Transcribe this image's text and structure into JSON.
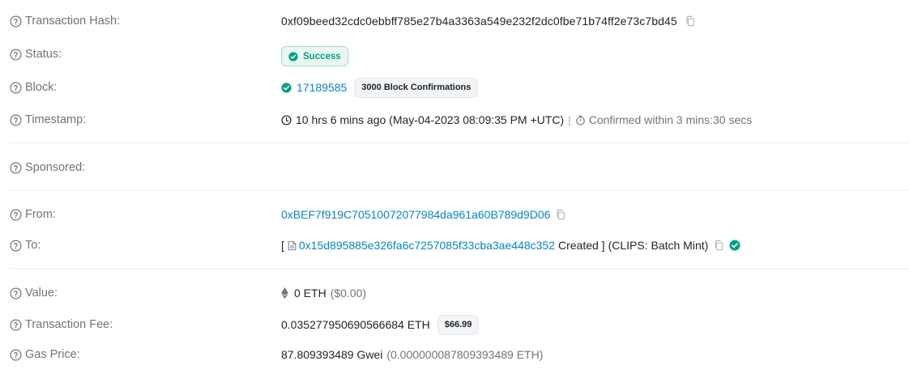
{
  "rows": {
    "tx_hash": {
      "label": "Transaction Hash:",
      "value": "0xf09beed32cdc0ebbff785e27b4a3363a549e232f2dc0fbe71b74ff2e73c7bd45"
    },
    "status": {
      "label": "Status:",
      "badge": "Success"
    },
    "block": {
      "label": "Block:",
      "number": "17189585",
      "confirmations": "3000 Block Confirmations"
    },
    "timestamp": {
      "label": "Timestamp:",
      "relative": "10 hrs 6 mins ago (May-04-2023 08:09:35 PM +UTC)",
      "separator": "|",
      "confirmed": "Confirmed within 3 mins:30 secs"
    },
    "sponsored": {
      "label": "Sponsored:"
    },
    "from": {
      "label": "From:",
      "address": "0xBEF7f919C70510072077984da961a60B789d9D06"
    },
    "to": {
      "label": "To:",
      "open_bracket": "[",
      "contract": "0x15d895885e326fa6c7257085f33cba3ae448c352",
      "created": "Created ]",
      "name": "(CLIPS: Batch Mint)"
    },
    "value": {
      "label": "Value:",
      "eth": "0 ETH",
      "usd": "($0.00)"
    },
    "fee": {
      "label": "Transaction Fee:",
      "eth": "0.035277950690566684 ETH",
      "usd_badge": "$66.99"
    },
    "gas": {
      "label": "Gas Price:",
      "gwei": "87.809393489 Gwei",
      "eth": "(0.000000087809393489 ETH)"
    }
  },
  "colors": {
    "link": "#0784c3",
    "success": "#00a186",
    "muted": "#6c757d",
    "divider": "#e9ecef"
  },
  "icons": {
    "help": "question-circle-icon",
    "copy": "copy-icon",
    "check": "check-circle-icon",
    "clock": "clock-icon",
    "timer": "stopwatch-icon",
    "eth": "ethereum-icon",
    "document": "document-icon",
    "verified": "verified-icon"
  }
}
